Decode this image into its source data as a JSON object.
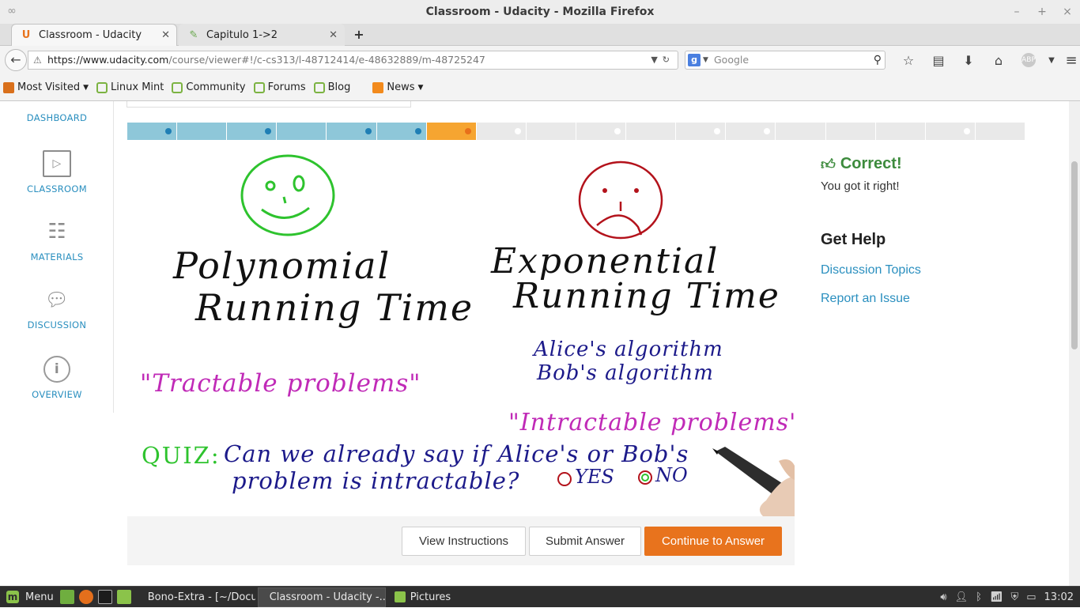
{
  "window": {
    "title": "Classroom - Udacity - Mozilla Firefox",
    "controls": [
      "–",
      "+",
      "×"
    ]
  },
  "tabs": [
    {
      "label": "Classroom - Udacity",
      "favicon": "U",
      "active": true
    },
    {
      "label": "Capitulo 1->2",
      "favicon": "✎",
      "active": false
    }
  ],
  "newtab_icon": "+",
  "url": {
    "host": "https://www.udacity.com",
    "path": "/course/viewer#!/c-cs313/l-48712414/e-48632889/m-48725247"
  },
  "search": {
    "engine_icon": "g",
    "placeholder": "Google"
  },
  "bookmarks": [
    {
      "label": "Most Visited",
      "icon": "star",
      "dropdown": true
    },
    {
      "label": "Linux Mint",
      "icon": "mint",
      "dropdown": false
    },
    {
      "label": "Community",
      "icon": "mint",
      "dropdown": false
    },
    {
      "label": "Forums",
      "icon": "mint",
      "dropdown": false
    },
    {
      "label": "Blog",
      "icon": "mint",
      "dropdown": false
    },
    {
      "label": "News",
      "icon": "rss",
      "dropdown": true
    }
  ],
  "sidebar": {
    "items": [
      {
        "label": "DASHBOARD",
        "icon": "dashboard-icon"
      },
      {
        "label": "CLASSROOM",
        "icon": "play-icon"
      },
      {
        "label": "MATERIALS",
        "icon": "notebook-icon"
      },
      {
        "label": "DISCUSSION",
        "icon": "chat-bubbles-icon"
      },
      {
        "label": "OVERVIEW",
        "icon": "info-icon"
      }
    ]
  },
  "progress": {
    "segments": [
      "done",
      "done",
      "done",
      "done",
      "done",
      "done",
      "current",
      "todo",
      "todo",
      "todo",
      "todo",
      "todo",
      "todo",
      "todo",
      "todo",
      "todo",
      "todo",
      "todo"
    ],
    "dots": [
      true,
      false,
      true,
      false,
      true,
      true,
      true,
      true,
      false,
      true,
      false,
      true,
      true,
      false,
      false,
      false,
      true,
      false
    ]
  },
  "video": {
    "polynomial_line1": "Polynomial",
    "polynomial_line2": "Running Time",
    "exponential_line1": "Exponential",
    "exponential_line2": "Running Time",
    "alice": "Alice's algorithm",
    "bob": "Bob's algorithm",
    "tractable": "\"Tractable problems\"",
    "intractable": "\"Intractable problems\"",
    "quiz_label": "QUIZ:",
    "quiz_line1": "Can we already say if Alice's or Bob's",
    "quiz_line2": "problem is intractable?",
    "option_yes": "YES",
    "option_no": "NO"
  },
  "buttons": {
    "view_instructions": "View Instructions",
    "submit_answer": "Submit Answer",
    "continue_to_answer": "Continue to Answer"
  },
  "feedback": {
    "title": "Correct!",
    "message": "You got it right!"
  },
  "help": {
    "title": "Get Help",
    "discussion_topics": "Discussion Topics",
    "report_issue": "Report an Issue"
  },
  "taskbar": {
    "menu": "Menu",
    "tasks": [
      {
        "label": "Bono-Extra - [~/Docu...",
        "active": false
      },
      {
        "label": "Classroom - Udacity -...",
        "active": true
      },
      {
        "label": "Pictures",
        "active": false
      }
    ],
    "clock": "13:02"
  },
  "colors": {
    "accent_orange": "#e8731d",
    "link_blue": "#2a8fbf",
    "correct_green": "#3d8b3d",
    "ink_green": "#2ec32e",
    "ink_red": "#b3121b",
    "ink_magenta": "#c02ab7",
    "ink_navy": "#1c1a8a"
  }
}
